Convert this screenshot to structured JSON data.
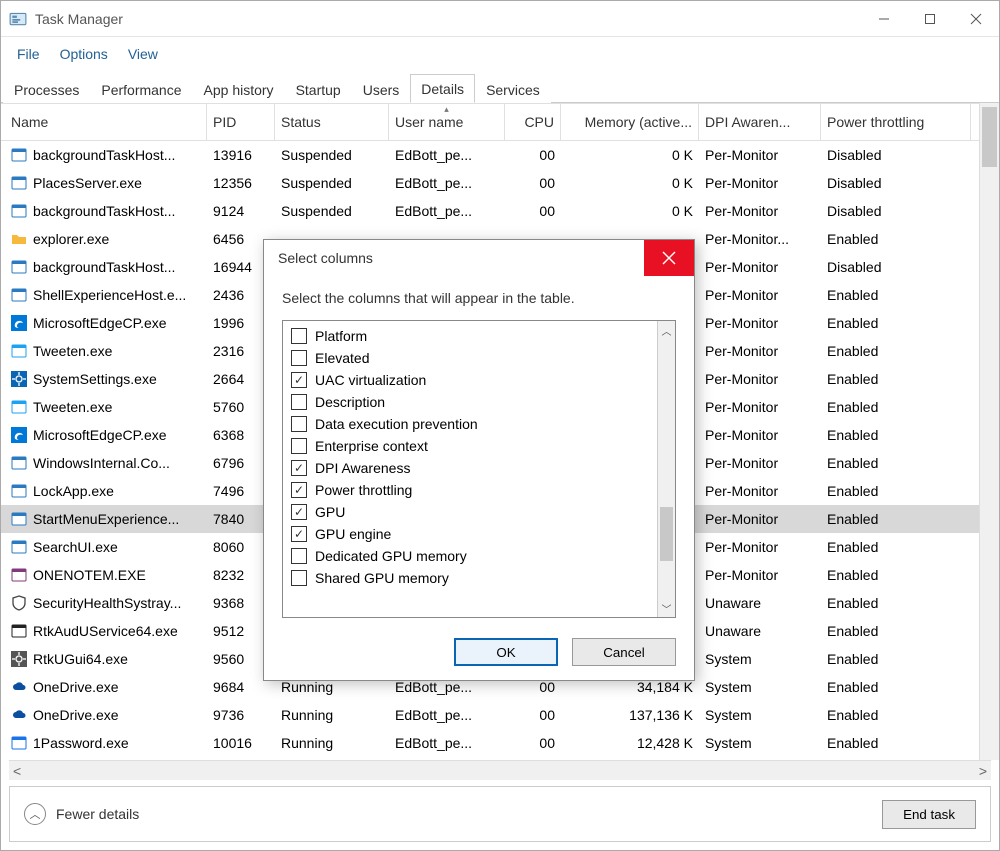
{
  "window": {
    "title": "Task Manager"
  },
  "menu": {
    "file": "File",
    "options": "Options",
    "view": "View"
  },
  "tabs": {
    "items": [
      "Processes",
      "Performance",
      "App history",
      "Startup",
      "Users",
      "Details",
      "Services"
    ],
    "activeIndex": 5
  },
  "columns": [
    "Name",
    "PID",
    "Status",
    "User name",
    "CPU",
    "Memory (active...",
    "DPI Awaren...",
    "Power throttling"
  ],
  "rows": [
    {
      "icon": "app",
      "name": "backgroundTaskHost...",
      "pid": "13916",
      "status": "Suspended",
      "user": "EdBott_pe...",
      "cpu": "00",
      "mem": "0 K",
      "dpi": "Per-Monitor",
      "pow": "Disabled"
    },
    {
      "icon": "app",
      "name": "PlacesServer.exe",
      "pid": "12356",
      "status": "Suspended",
      "user": "EdBott_pe...",
      "cpu": "00",
      "mem": "0 K",
      "dpi": "Per-Monitor",
      "pow": "Disabled"
    },
    {
      "icon": "app",
      "name": "backgroundTaskHost...",
      "pid": "9124",
      "status": "Suspended",
      "user": "EdBott_pe...",
      "cpu": "00",
      "mem": "0 K",
      "dpi": "Per-Monitor",
      "pow": "Disabled"
    },
    {
      "icon": "folder",
      "name": "explorer.exe",
      "pid": "6456",
      "status": "",
      "user": "",
      "cpu": "",
      "mem": "",
      "dpi": "Per-Monitor...",
      "pow": "Enabled"
    },
    {
      "icon": "app",
      "name": "backgroundTaskHost...",
      "pid": "16944",
      "status": "",
      "user": "",
      "cpu": "",
      "mem": "",
      "dpi": "Per-Monitor",
      "pow": "Disabled"
    },
    {
      "icon": "app",
      "name": "ShellExperienceHost.e...",
      "pid": "2436",
      "status": "",
      "user": "",
      "cpu": "",
      "mem": "",
      "dpi": "Per-Monitor",
      "pow": "Enabled"
    },
    {
      "icon": "edge",
      "name": "MicrosoftEdgeCP.exe",
      "pid": "1996",
      "status": "",
      "user": "",
      "cpu": "",
      "mem": "",
      "dpi": "Per-Monitor",
      "pow": "Enabled"
    },
    {
      "icon": "tweet",
      "name": "Tweeten.exe",
      "pid": "2316",
      "status": "",
      "user": "",
      "cpu": "",
      "mem": "",
      "dpi": "Per-Monitor",
      "pow": "Enabled"
    },
    {
      "icon": "gear",
      "name": "SystemSettings.exe",
      "pid": "2664",
      "status": "",
      "user": "",
      "cpu": "",
      "mem": "",
      "dpi": "Per-Monitor",
      "pow": "Enabled"
    },
    {
      "icon": "tweet",
      "name": "Tweeten.exe",
      "pid": "5760",
      "status": "",
      "user": "",
      "cpu": "",
      "mem": "",
      "dpi": "Per-Monitor",
      "pow": "Enabled"
    },
    {
      "icon": "edge",
      "name": "MicrosoftEdgeCP.exe",
      "pid": "6368",
      "status": "",
      "user": "",
      "cpu": "",
      "mem": "",
      "dpi": "Per-Monitor",
      "pow": "Enabled"
    },
    {
      "icon": "app",
      "name": "WindowsInternal.Co...",
      "pid": "6796",
      "status": "",
      "user": "",
      "cpu": "",
      "mem": "",
      "dpi": "Per-Monitor",
      "pow": "Enabled"
    },
    {
      "icon": "app",
      "name": "LockApp.exe",
      "pid": "7496",
      "status": "",
      "user": "",
      "cpu": "",
      "mem": "",
      "dpi": "Per-Monitor",
      "pow": "Enabled"
    },
    {
      "icon": "app",
      "name": "StartMenuExperience...",
      "pid": "7840",
      "status": "",
      "user": "",
      "cpu": "",
      "mem": "",
      "dpi": "Per-Monitor",
      "pow": "Enabled",
      "selected": true
    },
    {
      "icon": "app",
      "name": "SearchUI.exe",
      "pid": "8060",
      "status": "",
      "user": "",
      "cpu": "",
      "mem": "",
      "dpi": "Per-Monitor",
      "pow": "Enabled"
    },
    {
      "icon": "onenote",
      "name": "ONENOTEM.EXE",
      "pid": "8232",
      "status": "",
      "user": "",
      "cpu": "",
      "mem": "",
      "dpi": "Per-Monitor",
      "pow": "Enabled"
    },
    {
      "icon": "shield",
      "name": "SecurityHealthSystray...",
      "pid": "9368",
      "status": "",
      "user": "",
      "cpu": "",
      "mem": "",
      "dpi": "Unaware",
      "pow": "Enabled"
    },
    {
      "icon": "black",
      "name": "RtkAudUService64.exe",
      "pid": "9512",
      "status": "",
      "user": "",
      "cpu": "",
      "mem": "",
      "dpi": "Unaware",
      "pow": "Enabled"
    },
    {
      "icon": "gear2",
      "name": "RtkUGui64.exe",
      "pid": "9560",
      "status": "",
      "user": "",
      "cpu": "",
      "mem": "",
      "dpi": "System",
      "pow": "Enabled"
    },
    {
      "icon": "cloud",
      "name": "OneDrive.exe",
      "pid": "9684",
      "status": "Running",
      "user": "EdBott_pe...",
      "cpu": "00",
      "mem": "34,184 K",
      "dpi": "System",
      "pow": "Enabled"
    },
    {
      "icon": "cloud",
      "name": "OneDrive.exe",
      "pid": "9736",
      "status": "Running",
      "user": "EdBott_pe...",
      "cpu": "00",
      "mem": "137,136 K",
      "dpi": "System",
      "pow": "Enabled"
    },
    {
      "icon": "1p",
      "name": "1Password.exe",
      "pid": "10016",
      "status": "Running",
      "user": "EdBott_pe...",
      "cpu": "00",
      "mem": "12,428 K",
      "dpi": "System",
      "pow": "Enabled"
    }
  ],
  "dialog": {
    "title": "Select columns",
    "hint": "Select the columns that will appear in the table.",
    "items": [
      {
        "label": "Platform",
        "checked": false
      },
      {
        "label": "Elevated",
        "checked": false
      },
      {
        "label": "UAC virtualization",
        "checked": true
      },
      {
        "label": "Description",
        "checked": false
      },
      {
        "label": "Data execution prevention",
        "checked": false
      },
      {
        "label": "Enterprise context",
        "checked": false
      },
      {
        "label": "DPI Awareness",
        "checked": true
      },
      {
        "label": "Power throttling",
        "checked": true
      },
      {
        "label": "GPU",
        "checked": true
      },
      {
        "label": "GPU engine",
        "checked": true
      },
      {
        "label": "Dedicated GPU memory",
        "checked": false
      },
      {
        "label": "Shared GPU memory",
        "checked": false
      }
    ],
    "ok": "OK",
    "cancel": "Cancel"
  },
  "footer": {
    "fewer": "Fewer details",
    "endtask": "End task"
  }
}
